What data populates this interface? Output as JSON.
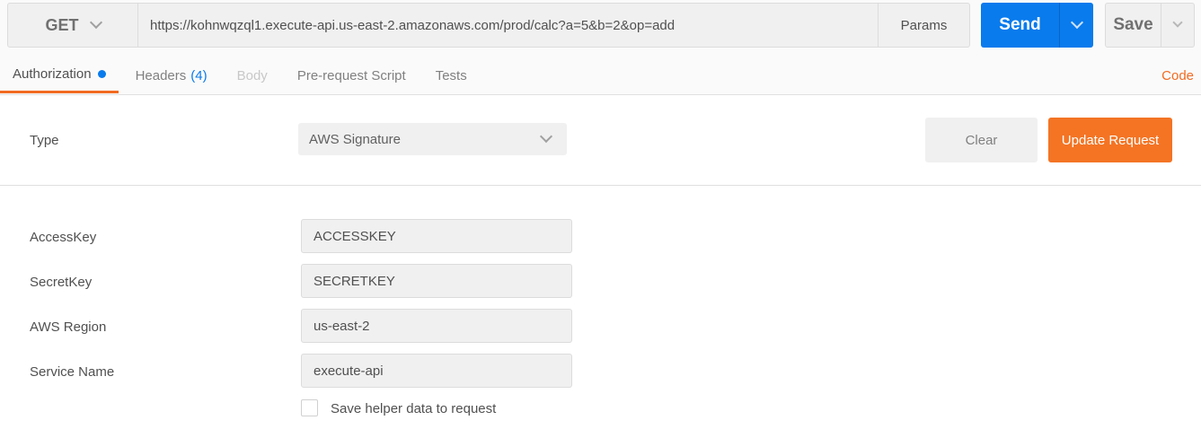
{
  "request": {
    "method": "GET",
    "url": "https://kohnwqzql1.execute-api.us-east-2.amazonaws.com/prod/calc?a=5&b=2&op=add",
    "params_label": "Params",
    "send_label": "Send",
    "save_label": "Save"
  },
  "tabs": [
    {
      "label": "Authorization"
    },
    {
      "label": "Headers",
      "count": "(4)"
    },
    {
      "label": "Body"
    },
    {
      "label": "Pre-request Script"
    },
    {
      "label": "Tests"
    }
  ],
  "code_label": "Code",
  "auth": {
    "type_label": "Type",
    "type_value": "AWS Signature",
    "clear_label": "Clear",
    "update_label": "Update Request",
    "fields": [
      {
        "label": "AccessKey",
        "value": "ACCESSKEY"
      },
      {
        "label": "SecretKey",
        "value": "SECRETKEY"
      },
      {
        "label": "AWS Region",
        "value": "us-east-2"
      },
      {
        "label": "Service Name",
        "value": "execute-api"
      }
    ],
    "save_helper_label": "Save helper data to request",
    "save_helper_checked": false
  },
  "colors": {
    "accent": "#f26b21",
    "primary": "#097bed"
  }
}
